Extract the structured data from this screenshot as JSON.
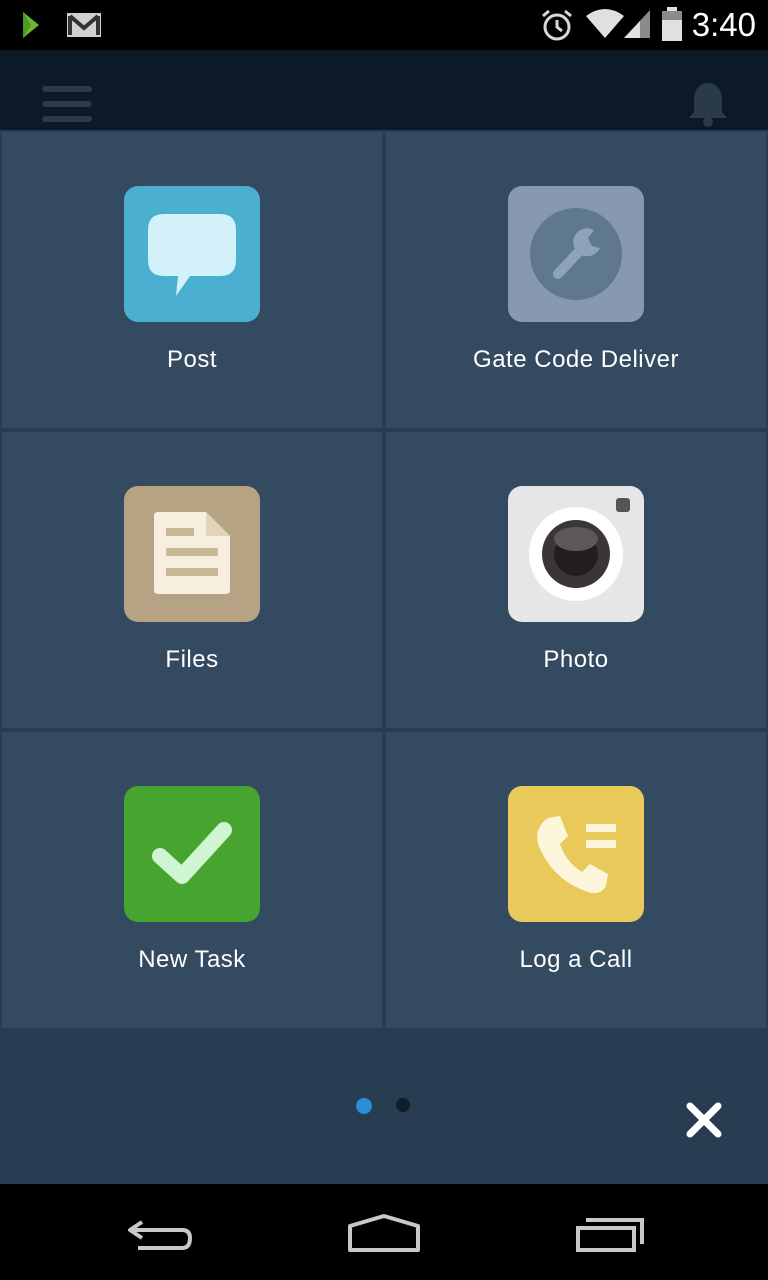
{
  "status_bar": {
    "time": "3:40",
    "icons": [
      "play-store-icon",
      "gmail-icon",
      "alarm-icon",
      "wifi-icon",
      "cell-signal-icon",
      "battery-icon"
    ]
  },
  "header": {
    "menu_icon": "hamburger-menu-icon",
    "notification_icon": "bell-icon"
  },
  "actions": [
    {
      "label": "Post",
      "icon": "speech-bubble-icon",
      "color": "#4bafd0"
    },
    {
      "label": "Gate Code Deliver",
      "icon": "wrench-icon",
      "color": "#8799ae"
    },
    {
      "label": "Files",
      "icon": "document-icon",
      "color": "#b6a383"
    },
    {
      "label": "Photo",
      "icon": "camera-icon",
      "color": "#e6e6e6"
    },
    {
      "label": "New Task",
      "icon": "checkmark-icon",
      "color": "#47a42f"
    },
    {
      "label": "Log a Call",
      "icon": "phone-icon",
      "color": "#e8c95a"
    }
  ],
  "pager": {
    "pages": 2,
    "current": 1,
    "active_color": "#2a8ed4",
    "inactive_color": "#0f1e2b"
  },
  "close_icon": "close-icon",
  "nav_bar": {
    "icons": [
      "back-icon",
      "home-icon",
      "recent-apps-icon"
    ]
  }
}
